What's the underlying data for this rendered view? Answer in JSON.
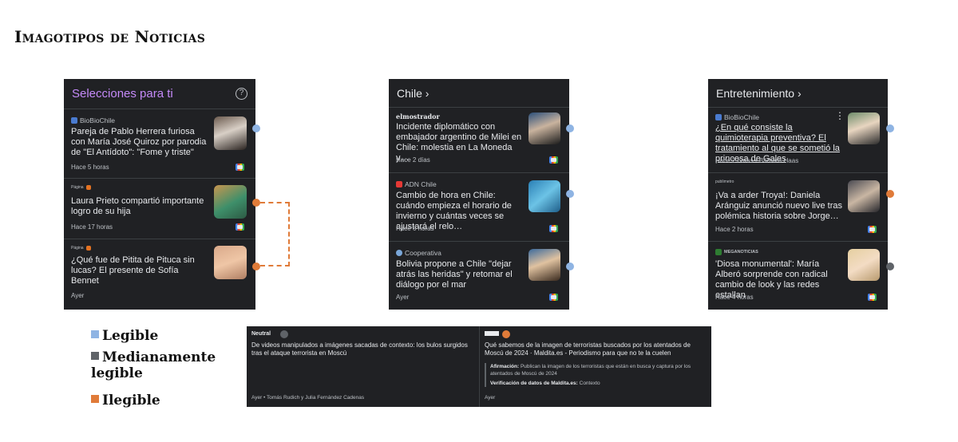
{
  "title": "Imagotipos de Noticias",
  "panel1": {
    "header": "Selecciones para ti",
    "items": [
      {
        "source": "BioBioChile",
        "headline": "Pareja de Pablo Herrera furiosa con María José Quiroz por parodia de \"El Antídoto\": \"Fome y triste\"",
        "time": "Hace 5 horas"
      },
      {
        "source": "Página 7",
        "headline": "Laura Prieto compartió importante logro de su hija",
        "time": "Hace 17 horas"
      },
      {
        "source": "Página 7",
        "headline": "¿Qué fue de Pitita de Pituca sin lucas? El presente de Sofía Bennet",
        "time": "Ayer"
      }
    ]
  },
  "panel2": {
    "header": "Chile ›",
    "items": [
      {
        "source": "elmostrador",
        "headline": "Incidente diplomático con embajador argentino de Milei en Chile: molestia en La Moneda y…",
        "time": "Hace 2 días"
      },
      {
        "source": "ADN Chile",
        "headline": "Cambio de hora en Chile: cuándo empieza el horario de invierno y cuántas veces se ajustará el relo…",
        "time": "Hace 6 horas"
      },
      {
        "source": "Cooperativa",
        "headline": "Bolivia propone a Chile \"dejar atrás las heridas\" y retomar el diálogo por el mar",
        "time": "Ayer"
      }
    ]
  },
  "panel3": {
    "header": "Entretenimiento ›",
    "items": [
      {
        "source": "BioBioChile",
        "headline": "¿En qué consiste la quimioterapia preventiva? El tratamiento al que se sometió la princesa de Gales",
        "time": "Hace 2 horas • Bárbara Haas"
      },
      {
        "source": "publimetro",
        "headline": "¡Va a arder Troya!: Daniela Aránguiz anunció nuevo live tras polémica historia sobre Jorge…",
        "time": "Hace 2 horas"
      },
      {
        "source": "MEGANOTICIAS",
        "headline": "'Diosa monumental': María Alberó sorprende con radical cambio de look y las redes estallan",
        "time": "Hace 4 horas"
      }
    ]
  },
  "legend": {
    "legible": "Legible",
    "medianamente": "Medianamente legible",
    "ilegible": "Ilegible"
  },
  "bottom": {
    "left": {
      "source": "Neutral",
      "headline": "De videos manipulados a imágenes sacadas de contexto: los bulos surgidos tras el ataque terrorista en Moscú",
      "meta": "Ayer • Tomás Rudich y Julia Fernández Cadenas"
    },
    "right": {
      "headline": "Qué sabemos de la imagen de terroristas buscados por los atentados de Moscú de 2024 · Maldita.es - Periodismo para que no te la cuelen",
      "claim_label": "Afirmación:",
      "claim_text": "Publican la imagen de los terroristas que están en busca y captura por los atentados de Moscú de 2024",
      "verif_label": "Verificación de datos de Maldita.es:",
      "verif_text": "Contexto",
      "meta": "Ayer"
    }
  },
  "colors": {
    "legible": "#8fb4e3",
    "medianamente": "#5f6368",
    "ilegible": "#e07b39",
    "panel_bg": "#202124"
  }
}
